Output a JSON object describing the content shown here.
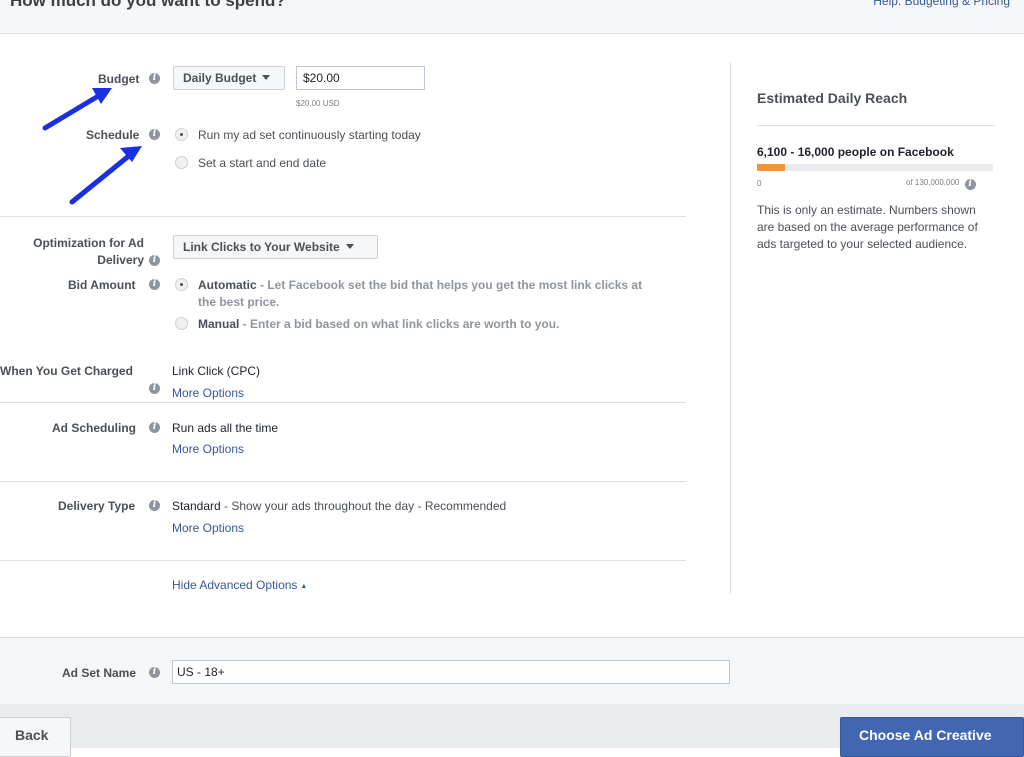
{
  "header": {
    "title": "How much do you want to spend?",
    "help_link": "Help: Budgeting & Pricing"
  },
  "budget": {
    "label": "Budget",
    "type_selected": "Daily Budget",
    "amount": "$20.00",
    "amount_note": "$20.00 USD"
  },
  "schedule": {
    "label": "Schedule",
    "options": [
      {
        "text": "Run my ad set continuously starting today",
        "checked": true
      },
      {
        "text": "Set a start and end date",
        "checked": false
      }
    ]
  },
  "optimization": {
    "label_line1": "Optimization for Ad",
    "label_line2": "Delivery",
    "selected": "Link Clicks to Your Website"
  },
  "bid_amount": {
    "label": "Bid Amount",
    "automatic": {
      "title": "Automatic",
      "desc_line1": " - Let Facebook set the bid that helps you get the most link clicks at",
      "desc_line2": "the best price.",
      "checked": true
    },
    "manual": {
      "title": "Manual",
      "desc": " - Enter a bid based on what link clicks are worth to you.",
      "checked": false
    }
  },
  "charged": {
    "label": "When You Get Charged",
    "value": "Link Click (CPC)",
    "more": "More Options"
  },
  "ad_scheduling": {
    "label": "Ad Scheduling",
    "value": "Run ads all the time",
    "more": "More Options"
  },
  "delivery_type": {
    "label": "Delivery Type",
    "value_bold": "Standard",
    "value_rest": " - Show your ads throughout the day - Recommended",
    "more": "More Options"
  },
  "advanced": {
    "hide_label": "Hide Advanced Options"
  },
  "reach": {
    "title": "Estimated Daily Reach",
    "count": "6,100 - 16,000 people on Facebook",
    "bar_fraction": 0.12,
    "min": "0",
    "max": "of 130,000,000",
    "note": "This is only an estimate. Numbers shown are based on the average performance of ads targeted to your selected audience."
  },
  "ad_set_name": {
    "label": "Ad Set Name",
    "value": "US - 18+"
  },
  "footer": {
    "back": "Back",
    "next": "Choose Ad Creative"
  },
  "colors": {
    "accent": "#4267b2",
    "link": "#365899",
    "reach_bar": "#f7923a",
    "annotation_arrow": "#1a2fe0"
  },
  "icons": [
    "info-icon",
    "caret-down-icon",
    "radio-button",
    "arrow-annotation"
  ]
}
